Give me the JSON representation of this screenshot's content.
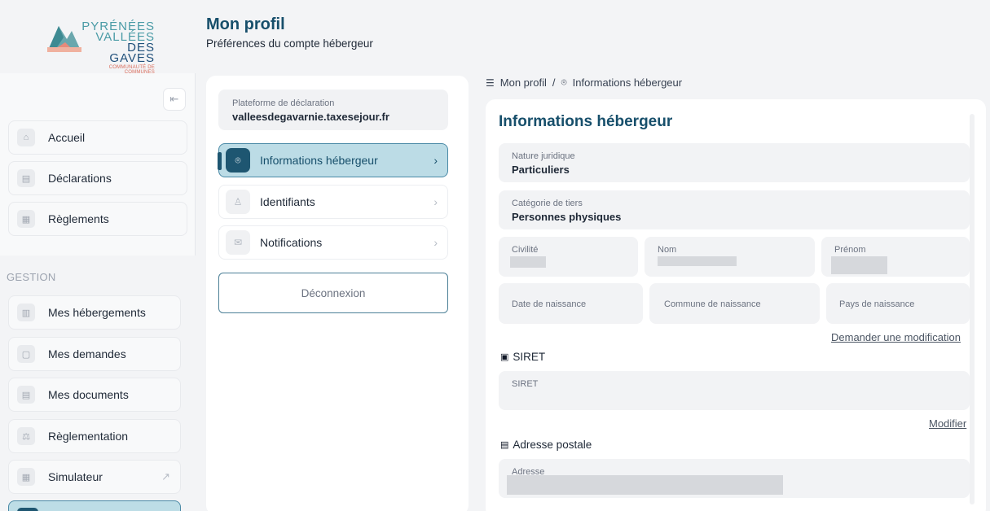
{
  "brand": {
    "line1": "PYRÉNÉES",
    "line2": "VALLÉES",
    "line3": "DES GAVES",
    "tagline": "COMMUNAUTÉ DE COMMUNES"
  },
  "sidebar": {
    "collapse_icon": "collapse-left-icon",
    "items_top": [
      {
        "label": "Accueil",
        "icon": "home-icon"
      },
      {
        "label": "Déclarations",
        "icon": "document-icon"
      },
      {
        "label": "Règlements",
        "icon": "receipt-icon"
      }
    ],
    "section_label": "GESTION",
    "items_gestion": [
      {
        "label": "Mes hébergements",
        "icon": "building-icon"
      },
      {
        "label": "Mes demandes",
        "icon": "chat-icon"
      },
      {
        "label": "Mes documents",
        "icon": "file-icon"
      },
      {
        "label": "Règlementation",
        "icon": "scale-icon"
      },
      {
        "label": "Simulateur",
        "icon": "calculator-icon",
        "external": "external-link-icon"
      }
    ]
  },
  "header": {
    "title": "Mon profil",
    "subtitle": "Préférences du compte hébergeur"
  },
  "profile_menu": {
    "platform_label": "Plateforme de déclaration",
    "platform_value": "valleesdegavarnie.taxesejour.fr",
    "items": [
      {
        "label": "Informations hébergeur",
        "icon": "face-scan-icon",
        "active": true
      },
      {
        "label": "Identifiants",
        "icon": "user-lock-icon",
        "active": false
      },
      {
        "label": "Notifications",
        "icon": "mail-icon",
        "active": false
      }
    ],
    "logout_label": "Déconnexion"
  },
  "breadcrumb": {
    "root": "Mon profil",
    "separator": "/",
    "current": "Informations hébergeur"
  },
  "info": {
    "title": "Informations hébergeur",
    "nature_label": "Nature juridique",
    "nature_value": "Particuliers",
    "categorie_label": "Catégorie de tiers",
    "categorie_value": "Personnes physiques",
    "civilite_label": "Civilité",
    "nom_label": "Nom",
    "prenom_label": "Prénom",
    "date_naissance_label": "Date de naissance",
    "commune_naissance_label": "Commune de naissance",
    "pays_naissance_label": "Pays de naissance",
    "demander_modification": "Demander une modification",
    "siret_heading": "SIRET",
    "siret_label": "SIRET",
    "modifier": "Modifier",
    "adresse_heading": "Adresse postale",
    "adresse_label": "Adresse"
  },
  "colors": {
    "brand_dark": "#174f6b",
    "active_bg": "#bcdce6",
    "active_icon": "#1e5671"
  }
}
